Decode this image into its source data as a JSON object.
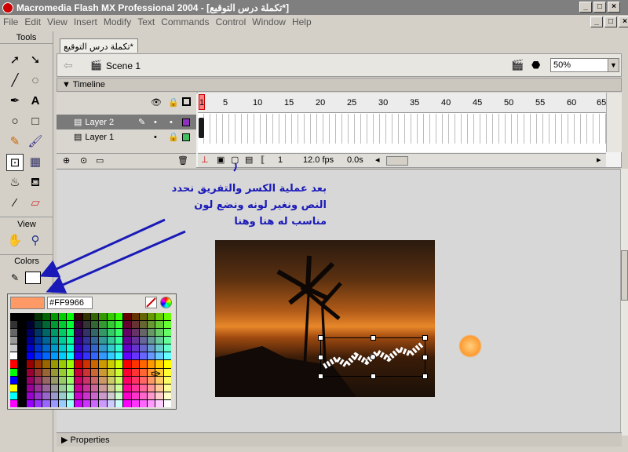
{
  "window": {
    "title": "Macromedia Flash MX Professional 2004 - [تكملة درس التوقيع*]"
  },
  "menu": [
    "File",
    "Edit",
    "View",
    "Insert",
    "Modify",
    "Text",
    "Commands",
    "Control",
    "Window",
    "Help"
  ],
  "tools_panel": {
    "title": "Tools",
    "view_label": "View",
    "colors_label": "Colors"
  },
  "document": {
    "tab_label": "تكملة درس التوقيع*",
    "scene_label": "Scene 1",
    "zoom": "50%"
  },
  "timeline": {
    "header": "Timeline",
    "layers": [
      {
        "name": "Layer 2"
      },
      {
        "name": "Layer 1"
      }
    ],
    "frame_numbers": [
      "1",
      "5",
      "10",
      "15",
      "20",
      "25",
      "30",
      "35",
      "40",
      "45",
      "50",
      "55",
      "60",
      "65"
    ],
    "current_frame": "1",
    "fps": "12.0 fps",
    "elapsed": "0.0s"
  },
  "annotation": {
    "line1": "بعد عملية الكسر والتفريق نحدد",
    "line2": "النص ونغير لونه ونضع لون",
    "line3": "مناسب له هنا وهنا"
  },
  "color_picker": {
    "hex_value": "#FF9966",
    "selected_color": "#ff9966"
  },
  "properties_label": "Properties",
  "colors": {
    "accent": "#1a1ab8",
    "title_bg": "#7f7f7f"
  }
}
